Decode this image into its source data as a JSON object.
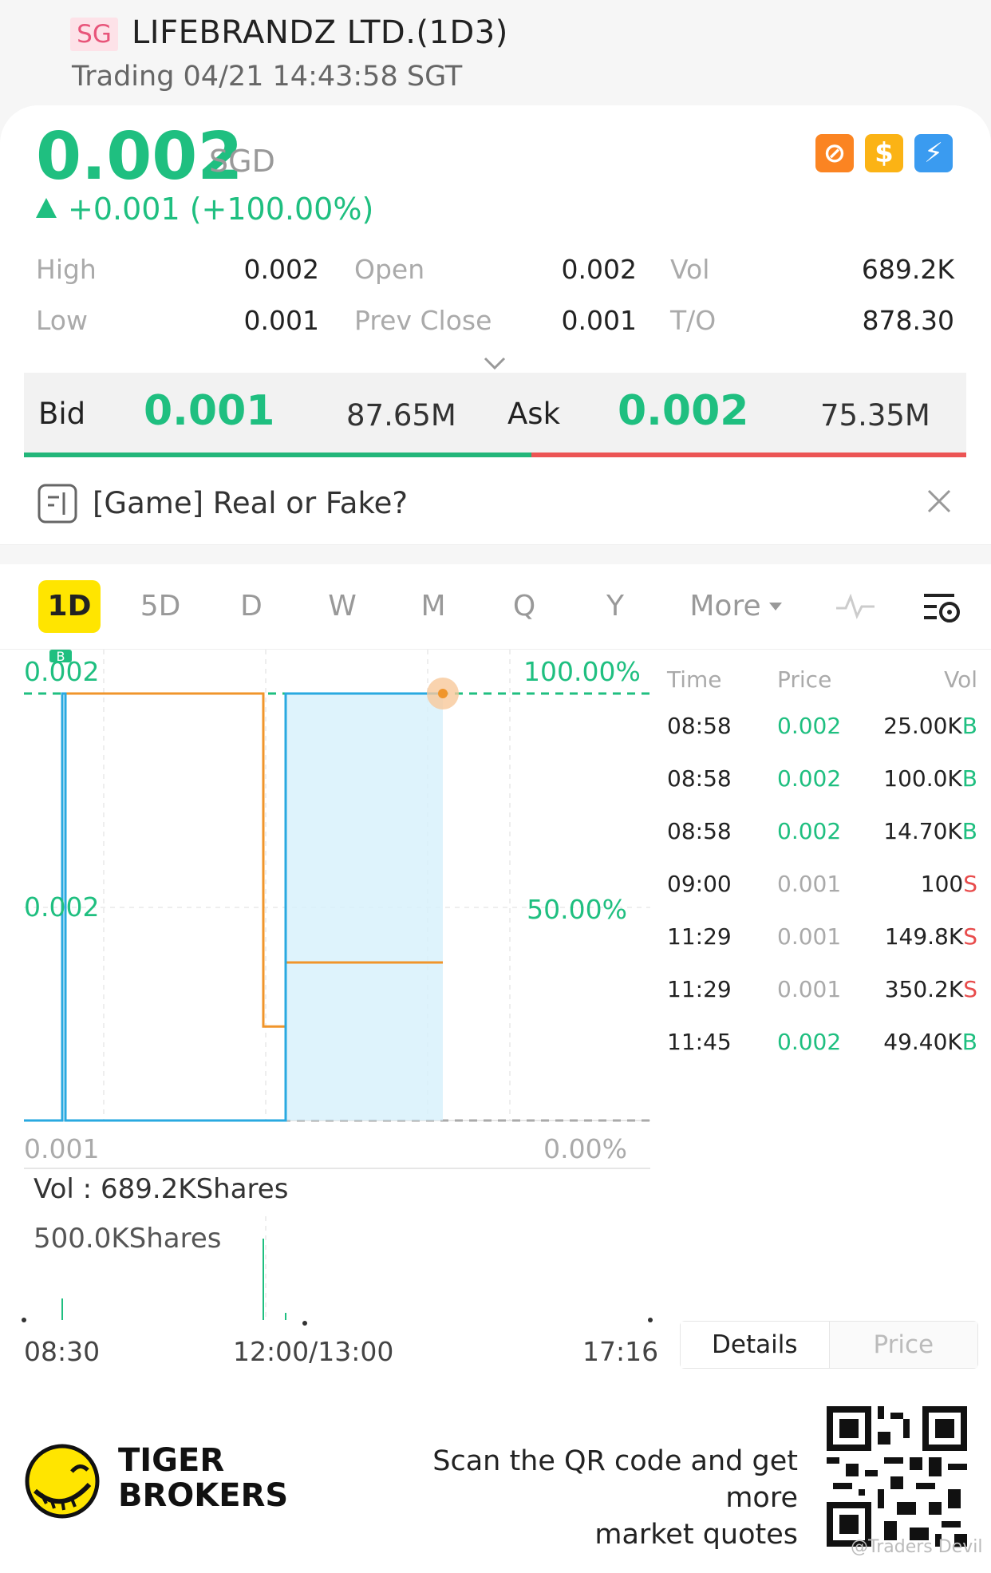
{
  "header": {
    "market": "SG",
    "name": "LIFEBRANDZ LTD.(1D3)",
    "status": "Trading 04/21 14:43:58 SGT"
  },
  "quote": {
    "price": "0.002",
    "currency": "SGD",
    "change": "+0.001 (+100.00%)",
    "icons": [
      "no-fee-icon",
      "dollar-icon",
      "lightning-icon"
    ]
  },
  "stats": {
    "high_label": "High",
    "high": "0.002",
    "open_label": "Open",
    "open": "0.002",
    "vol_label": "Vol",
    "vol": "689.2K",
    "low_label": "Low",
    "low": "0.001",
    "prev_close_label": "Prev Close",
    "prev_close": "0.001",
    "turnover_label": "T/O",
    "turnover": "878.30"
  },
  "bidask": {
    "bid_label": "Bid",
    "bid_price": "0.001",
    "bid_size": "87.65M",
    "ask_label": "Ask",
    "ask_price": "0.002",
    "ask_size": "75.35M"
  },
  "notice": {
    "text": "[Game] Real or Fake?"
  },
  "tabs": [
    "1D",
    "5D",
    "D",
    "W",
    "M",
    "Q",
    "Y",
    "More"
  ],
  "active_tab": "1D",
  "chart": {
    "y_top_price": "0.002",
    "y_mid_price": "0.002",
    "y_bottom_price": "0.001",
    "y_top_pct": "100.00%",
    "y_mid_pct": "50.00%",
    "y_bottom_pct": "0.00%",
    "vol_label": "Vol :",
    "vol_value": "689.2KShares",
    "vol_max": "500.0KShares",
    "time_start": "08:30",
    "time_mid": "12:00/13:00",
    "time_end": "17:16",
    "marker": "B"
  },
  "chart_data": {
    "type": "line",
    "x": [
      "08:30",
      "08:58",
      "11:29",
      "11:45",
      "14:43"
    ],
    "series": [
      {
        "values": [
          0.001,
          0.002,
          0.001,
          0.002,
          0.002
        ]
      }
    ],
    "ylim": [
      0.001,
      0.002
    ],
    "y_percent_range": [
      "0.00%",
      "100.00%"
    ],
    "x_ticks": [
      "08:30",
      "12:00/13:00",
      "17:16"
    ],
    "volume_axis_max": "500.0KShares",
    "total_volume": "689.2KShares",
    "grid": true
  },
  "trades": {
    "headers": [
      "Time",
      "Price",
      "Vol"
    ],
    "rows": [
      {
        "time": "08:58",
        "price": "0.002",
        "vol": "25.00K",
        "side": "B",
        "up": true
      },
      {
        "time": "08:58",
        "price": "0.002",
        "vol": "100.0K",
        "side": "B",
        "up": true
      },
      {
        "time": "08:58",
        "price": "0.002",
        "vol": "14.70K",
        "side": "B",
        "up": true
      },
      {
        "time": "09:00",
        "price": "0.001",
        "vol": "100",
        "side": "S",
        "up": false
      },
      {
        "time": "11:29",
        "price": "0.001",
        "vol": "149.8K",
        "side": "S",
        "up": false
      },
      {
        "time": "11:29",
        "price": "0.001",
        "vol": "350.2K",
        "side": "S",
        "up": false
      },
      {
        "time": "11:45",
        "price": "0.002",
        "vol": "49.40K",
        "side": "B",
        "up": true
      }
    ]
  },
  "toggle": {
    "details": "Details",
    "price": "Price"
  },
  "footer": {
    "brand_line1": "TIGER",
    "brand_line2": "BROKERS",
    "promo_line1": "Scan the QR code and get more",
    "promo_line2": "market quotes",
    "watermark": "@Traders Devil"
  },
  "colors": {
    "up": "#1fbf80",
    "down": "#e84c4c",
    "price_line": "#29a9e0",
    "avg_line": "#f0952b",
    "highlight_tab": "#ffe500"
  }
}
